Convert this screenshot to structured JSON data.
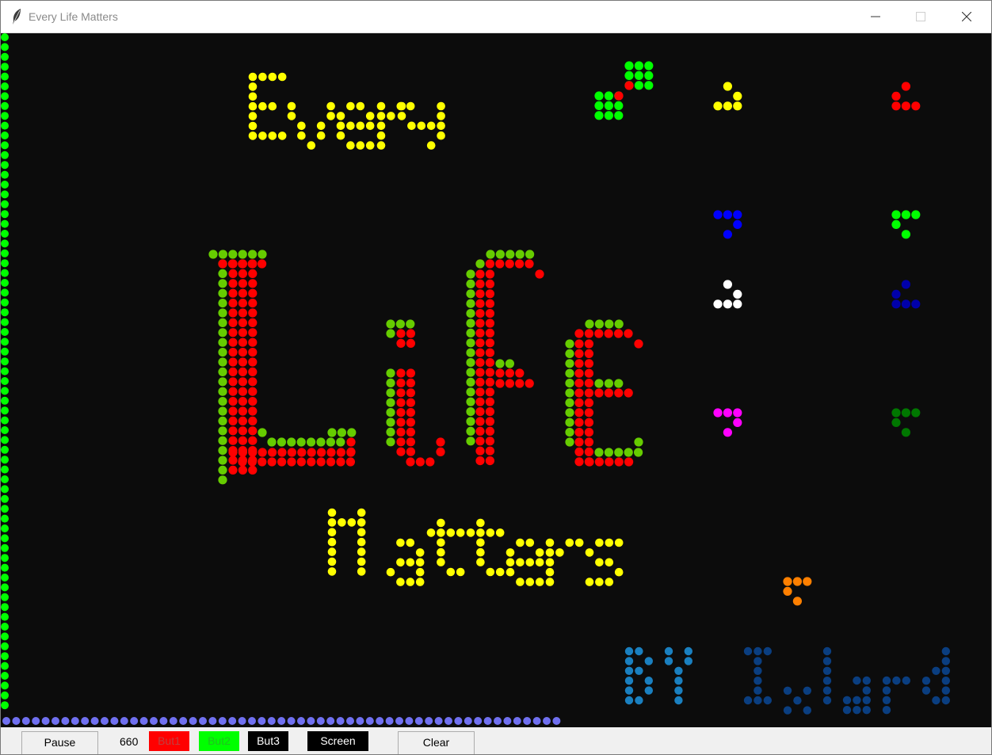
{
  "window": {
    "title": "Every Life Matters",
    "icon": "feather-icon"
  },
  "canvas": {
    "background": "#0c0c0c",
    "banner_words": [
      "Every",
      "Life",
      "Matters",
      "BY Ixlard"
    ],
    "colors": {
      "yellow": "#ffff00",
      "red": "#ff0000",
      "olive_green": "#66cc00",
      "lime": "#00ff00",
      "blue": "#0000ff",
      "white": "#ffffff",
      "navy": "#0000aa",
      "magenta": "#ff00ff",
      "dark_green": "#007700",
      "orange": "#ff8000",
      "periwinkle": "#7070f0",
      "signature_light_blue": "#1a80c0",
      "signature_dark_blue": "#0a3e80"
    }
  },
  "controls": {
    "pause_label": "Pause",
    "generation_count": "660",
    "but1_label": "But1",
    "but1_color": "#ff0000",
    "but2_label": "But2",
    "but2_color": "#00ff00",
    "but3_label": "But3",
    "but3_color": "#000000",
    "screen_label": "Screen",
    "screen_color": "#000000",
    "clear_label": "Clear"
  }
}
